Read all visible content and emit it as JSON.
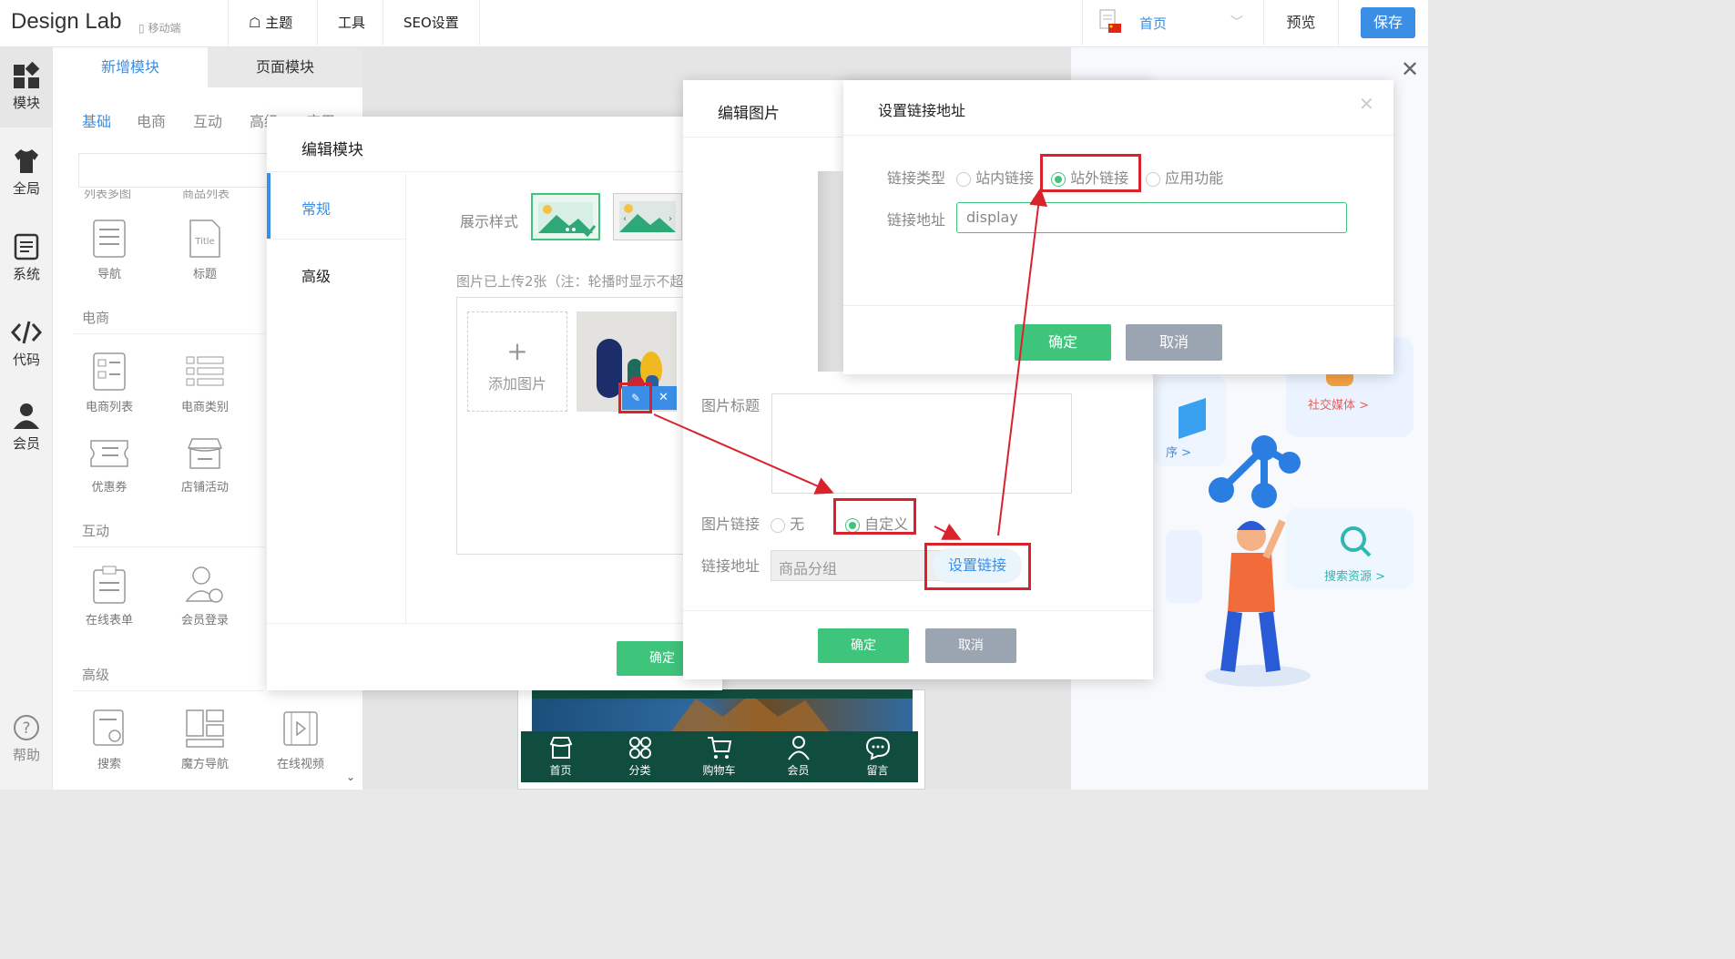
{
  "topbar": {
    "brand": "Design Lab",
    "mobile": "移动端",
    "nav": [
      "主题",
      "工具",
      "SEO设置"
    ],
    "home": "首页",
    "preview": "预览",
    "save": "保存"
  },
  "rail": [
    "模块",
    "全局",
    "系统",
    "代码",
    "会员",
    "帮助"
  ],
  "panel": {
    "tab_new": "新增模块",
    "tab_page": "页面模块",
    "subtabs": [
      "基础",
      "电商",
      "互动",
      "高级",
      "应用"
    ],
    "cut_labels": [
      "列表多图",
      "商品列表"
    ],
    "basic": [
      "导航",
      "标题"
    ],
    "sec_ecom": "电商",
    "ecom": [
      "电商列表",
      "电商类别",
      "优惠券",
      "店铺活动"
    ],
    "sec_interact": "互动",
    "interact": [
      "在线表单",
      "会员登录"
    ],
    "sec_adv": "高级",
    "adv": [
      "搜索",
      "魔方导航",
      "在线视频"
    ]
  },
  "edit_module": {
    "title": "编辑模块",
    "tab_general": "常规",
    "tab_adv": "高级",
    "display_style": "展示样式",
    "upload_note": "图片已上传2张（注：轮播时显示不超",
    "add_image": "添加图片",
    "ok": "确定"
  },
  "edit_image": {
    "title": "编辑图片",
    "img_title_label": "图片标题",
    "img_link_label": "图片链接",
    "opt_none": "无",
    "opt_custom": "自定义",
    "link_addr_label": "链接地址",
    "link_addr_value": "商品分组",
    "set_link": "设置链接",
    "ok": "确定",
    "cancel": "取消"
  },
  "set_link": {
    "title": "设置链接地址",
    "type_label": "链接类型",
    "opt_internal": "站内链接",
    "opt_external": "站外链接",
    "opt_app": "应用功能",
    "addr_label": "链接地址",
    "addr_value": "display",
    "ok": "确定",
    "cancel": "取消"
  },
  "promo": {
    "social": "社交媒体 >",
    "search": "搜索资源 >",
    "mini": "序 >"
  },
  "phone_nav": [
    "首页",
    "分类",
    "购物车",
    "会员",
    "留言"
  ],
  "colors": {
    "accent": "#3a8ee6",
    "green": "#3fc47c",
    "red": "#d9232c",
    "dark_green": "#114d3f"
  }
}
